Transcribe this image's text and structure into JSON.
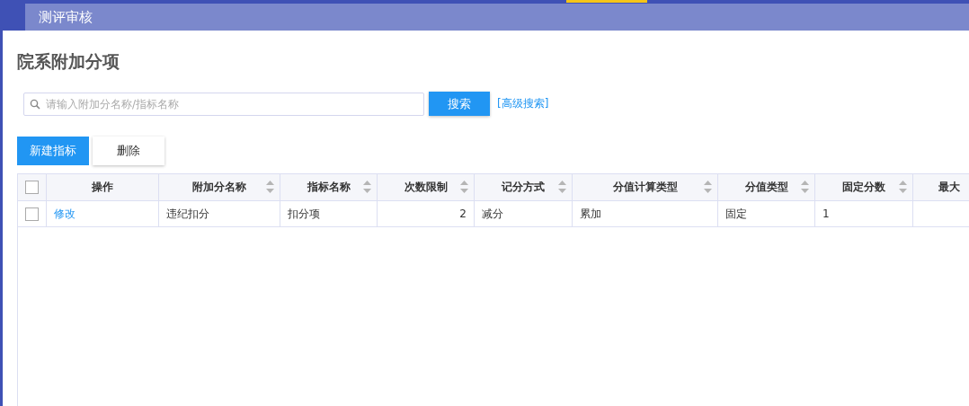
{
  "header": {
    "title": "测评审核"
  },
  "page_title": "院系附加分项",
  "search": {
    "placeholder": "请输入附加分名称/指标名称",
    "button": "搜索",
    "advanced_link": "[高级搜索]"
  },
  "actions": [
    {
      "label": "新建指标",
      "kind": "primary"
    },
    {
      "label": "删除",
      "kind": "plain"
    }
  ],
  "table": {
    "select_all_checked": false,
    "columns": [
      {
        "label": "操作",
        "sortable": false
      },
      {
        "label": "附加分名称",
        "sortable": true
      },
      {
        "label": "指标名称",
        "sortable": true
      },
      {
        "label": "次数限制",
        "sortable": true
      },
      {
        "label": "记分方式",
        "sortable": true
      },
      {
        "label": "分值计算类型",
        "sortable": true
      },
      {
        "label": "分值类型",
        "sortable": true
      },
      {
        "label": "固定分数",
        "sortable": true
      },
      {
        "label": "最大"
      }
    ],
    "rows": [
      {
        "checked": false,
        "link": "修改",
        "cells": [
          "违纪扣分",
          "扣分项",
          "2",
          "减分",
          "累加",
          "固定",
          "1"
        ]
      }
    ]
  }
}
